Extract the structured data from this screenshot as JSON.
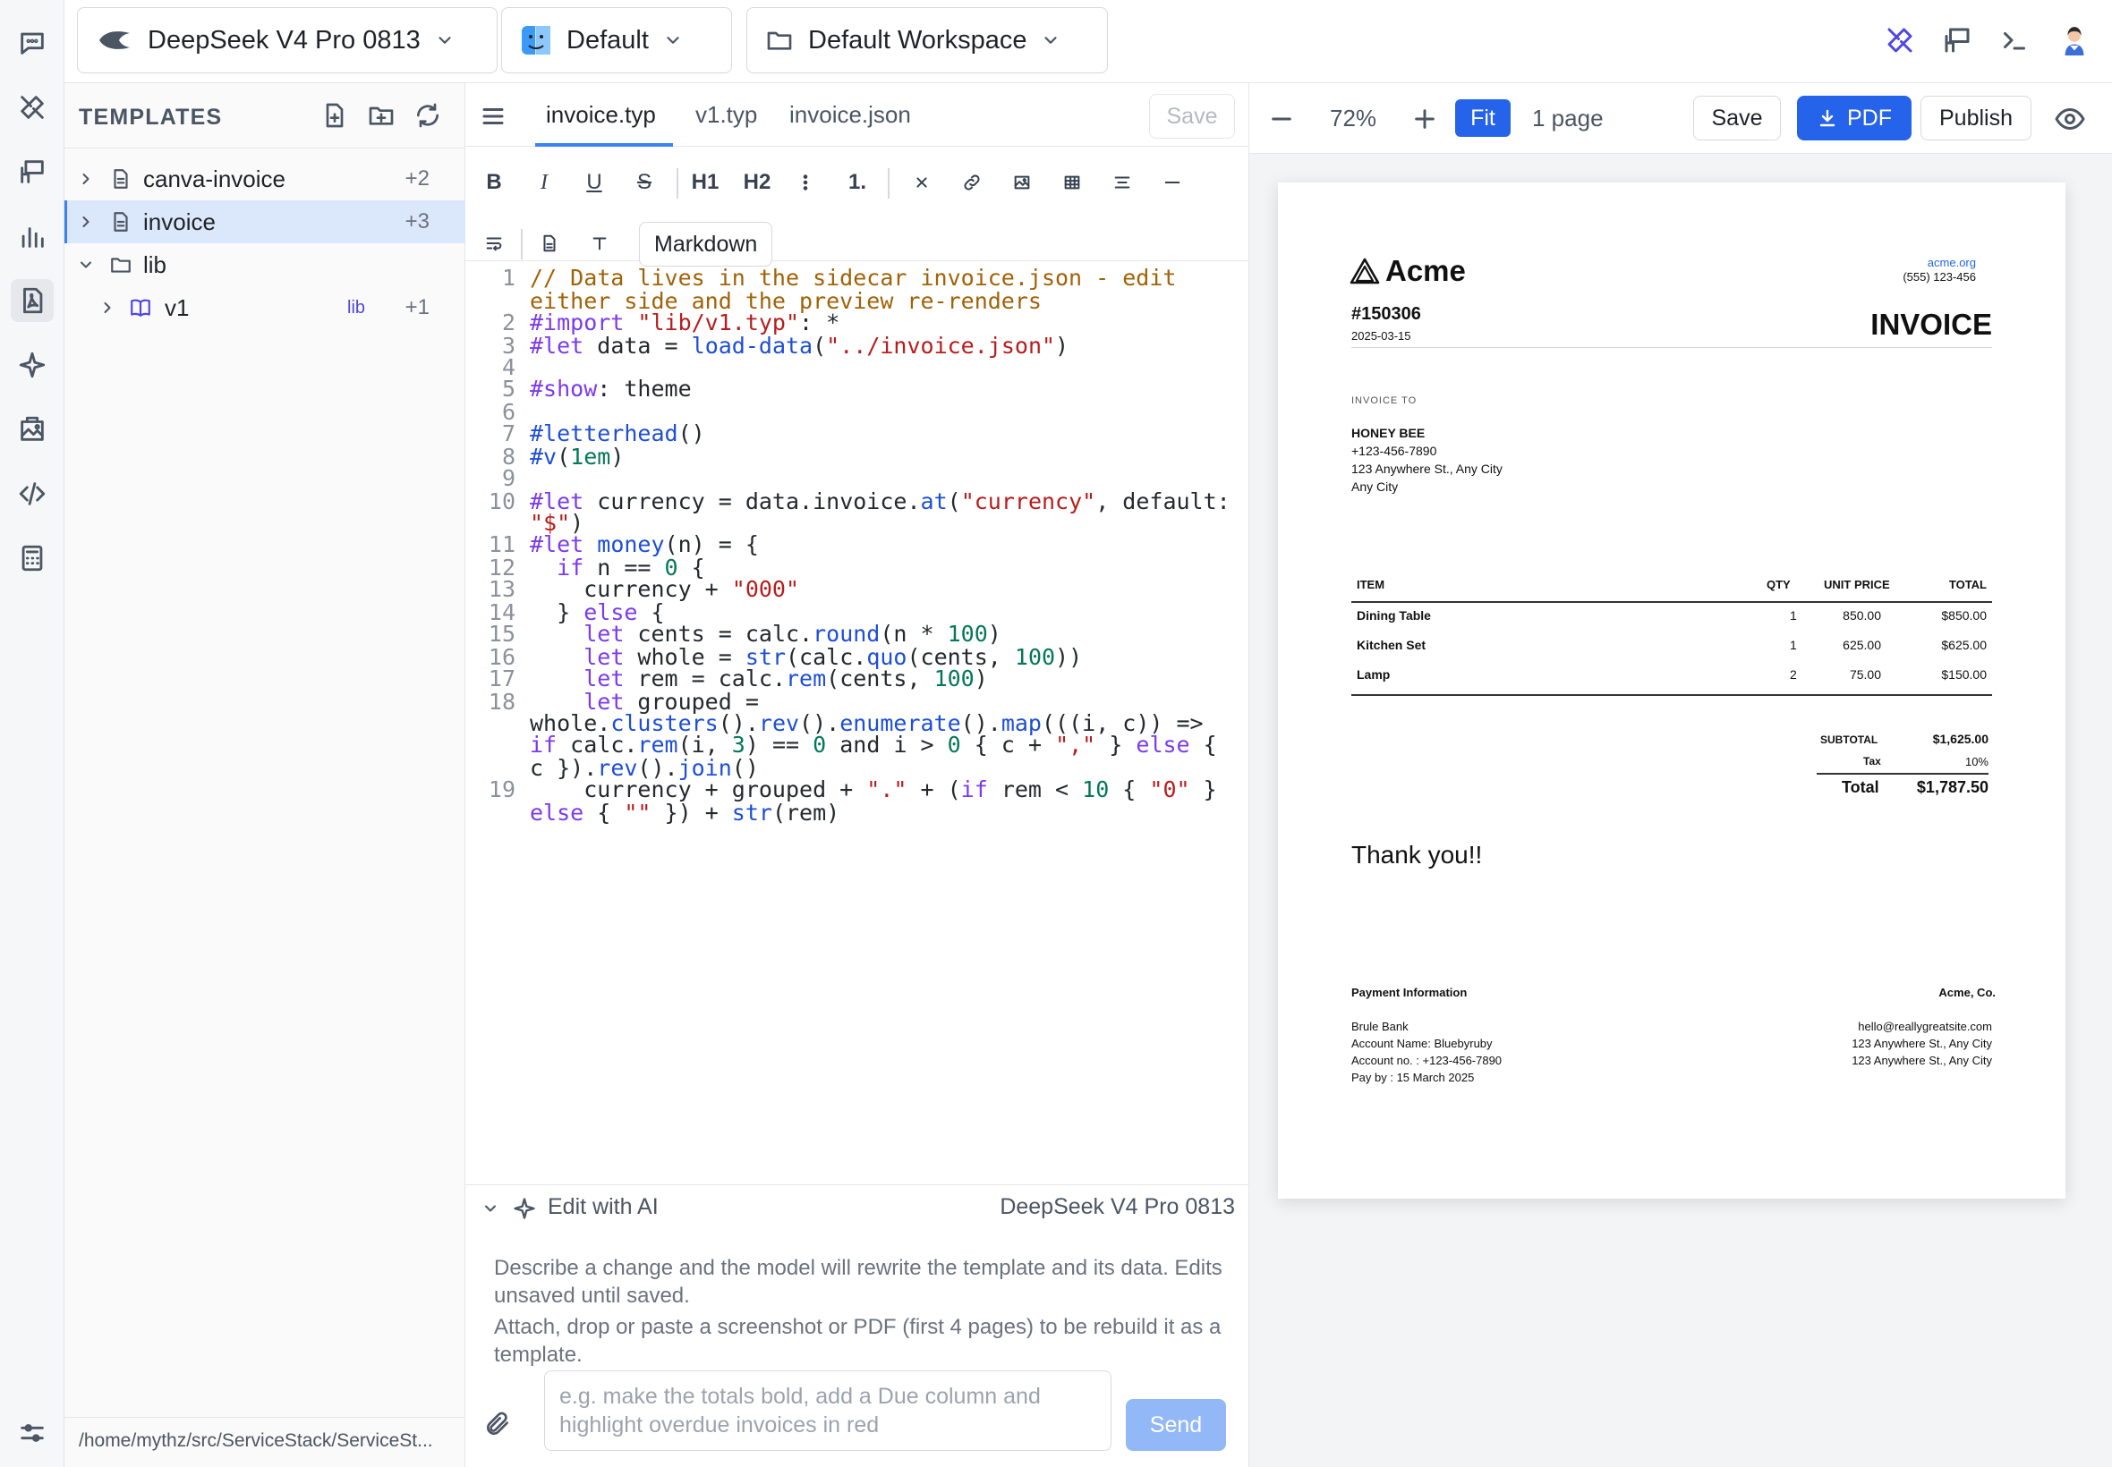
{
  "topbar": {
    "model": "DeepSeek V4 Pro 0813",
    "profile": "Default",
    "workspace": "Default Workspace"
  },
  "templates": {
    "title": "TEMPLATES",
    "items": [
      {
        "name": "canva-invoice",
        "count": "+2"
      },
      {
        "name": "invoice",
        "count": "+3"
      },
      {
        "name": "lib"
      },
      {
        "name": "v1",
        "badge": "lib",
        "count": "+1"
      }
    ],
    "path": "/home/mythz/src/ServiceStack/ServiceSt..."
  },
  "editor": {
    "tabs": [
      "invoice.typ",
      "v1.typ",
      "invoice.json"
    ],
    "save_label": "Save",
    "markdown_label": "Markdown",
    "format": {
      "h1": "H1",
      "h2": "H2",
      "ol": "1."
    },
    "line_numbers": [
      "1",
      "",
      "2",
      "3",
      "4",
      "5",
      "6",
      "7",
      "8",
      "9",
      "10",
      "",
      "11",
      "12",
      "13",
      "14",
      "15",
      "16",
      "17",
      "18",
      "",
      "",
      "",
      "19",
      ""
    ],
    "code_lines": [
      "// Data lives in the sidecar invoice.json - edit",
      "either side and the preview re-renders",
      "#import \"lib/v1.typ\": *",
      "#let data = load-data(\"../invoice.json\")",
      "",
      "#show: theme",
      "",
      "#letterhead()",
      "#v(1em)",
      "",
      "#let currency = data.invoice.at(\"currency\", default:",
      "\"$\")",
      "#let money(n) = {",
      "  if n == 0 {",
      "    currency + \"000\"",
      "  } else {",
      "    let cents = calc.round(n * 100)",
      "    let whole = str(calc.quo(cents, 100))",
      "    let rem = calc.rem(cents, 100)",
      "    let grouped =",
      "whole.clusters().rev().enumerate().map(((i, c)) =>",
      "if calc.rem(i, 3) == 0 and i > 0 { c + \",\" } else {",
      "c }).rev().join()",
      "    currency + grouped + \".\" + (if rem < 10 { \"0\" }",
      "else { \"\" }) + str(rem)"
    ],
    "ai": {
      "label": "Edit with AI",
      "model": "DeepSeek V4 Pro 0813",
      "desc1": "Describe a change and the model will rewrite the template and its data. Edits unsaved until saved.",
      "desc2": "Attach, drop or paste a screenshot or PDF (first 4 pages) to be rebuild it as a template.",
      "placeholder": "e.g. make the totals bold, add a Due column and highlight overdue invoices in red",
      "send_label": "Send"
    }
  },
  "preview": {
    "zoom": "72%",
    "fit_label": "Fit",
    "pages": "1 page",
    "save_label": "Save",
    "pdf_label": "PDF",
    "publish_label": "Publish"
  },
  "invoice": {
    "brand": "Acme",
    "site": "acme.org",
    "phone": "(555) 123-456",
    "number": "#150306",
    "date": "2025-03-15",
    "heading": "INVOICE",
    "to_label": "INVOICE TO",
    "to_name": "HONEY BEE",
    "to_phone": "+123-456-7890",
    "to_addr1": "123 Anywhere St., Any City",
    "to_addr2": "Any City",
    "columns": [
      "ITEM",
      "QTY",
      "UNIT PRICE",
      "TOTAL"
    ],
    "rows": [
      {
        "item": "Dining Table",
        "qty": "1",
        "price": "850.00",
        "total": "$850.00"
      },
      {
        "item": "Kitchen Set",
        "qty": "1",
        "price": "625.00",
        "total": "$625.00"
      },
      {
        "item": "Lamp",
        "qty": "2",
        "price": "75.00",
        "total": "$150.00"
      }
    ],
    "subtotal_label": "SUBTOTAL",
    "subtotal": "$1,625.00",
    "tax_label": "Tax",
    "tax": "10%",
    "total_label": "Total",
    "total": "$1,787.50",
    "thanks": "Thank you!!",
    "pay_label": "Payment Information",
    "company": "Acme, Co.",
    "pay_lines": [
      "Brule Bank",
      "Account Name: Bluebyruby",
      "Account no. : +123-456-7890",
      "Pay by : 15 March 2025"
    ],
    "company_lines": [
      "hello@reallygreatsite.com",
      "123 Anywhere St., Any City",
      "123 Anywhere St., Any City"
    ]
  },
  "colors": {
    "accent": "#2563eb",
    "selected_row": "#dbe8fb"
  }
}
